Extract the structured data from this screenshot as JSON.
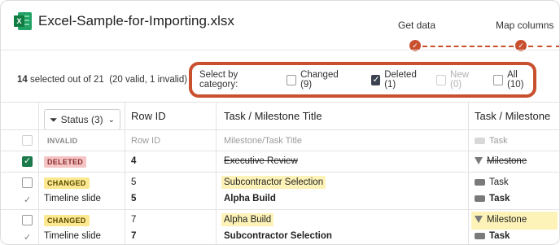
{
  "file": {
    "title": "Excel-Sample-for-Importing.xlsx",
    "icon": "excel-icon"
  },
  "stepper": {
    "steps": [
      {
        "label": "Get data",
        "status": "complete"
      },
      {
        "label": "Map columns",
        "status": "complete"
      }
    ]
  },
  "summary": {
    "selected_count": "14",
    "selected_text": "selected out of 21",
    "valid_text": "(20 valid, 1 invalid)"
  },
  "category_filter": {
    "label": "Select by category:",
    "options": [
      {
        "label": "Changed (9)",
        "checked": false,
        "disabled": false
      },
      {
        "label": "Deleted (1)",
        "checked": true,
        "disabled": false
      },
      {
        "label": "New (0)",
        "checked": false,
        "disabled": true
      },
      {
        "label": "All (10)",
        "checked": false,
        "disabled": false
      }
    ]
  },
  "table": {
    "status_filter": "Status (3)",
    "columns": [
      "Row ID",
      "Task / Milestone Title",
      "Task / Milestone"
    ],
    "header_row": {
      "status": "INVALID",
      "row_id": "Row ID",
      "title": "Milestone/Task Title",
      "type": "Task"
    },
    "rows": [
      {
        "status": "DELETED",
        "checked": true,
        "row_id": "4",
        "title": "Executive Review",
        "type": "Milestone"
      },
      {
        "status": "CHANGED",
        "checked": false,
        "row_id": "5",
        "title": "Subcontractor Selection",
        "type": "Task",
        "sub": {
          "label": "Timeline slide",
          "row_id": "5",
          "title": "Alpha Build",
          "type": "Task"
        }
      },
      {
        "status": "CHANGED",
        "checked": false,
        "row_id": "7",
        "title": "Alpha Build",
        "type": "Milestone",
        "sub": {
          "label": "Timeline slide",
          "row_id": "7",
          "title": "Subcontractor Selection",
          "type": "Task"
        }
      }
    ]
  },
  "colors": {
    "accent": "#c9502e",
    "highlight": "#fdf3b8",
    "checked_green": "#1a7a49"
  }
}
